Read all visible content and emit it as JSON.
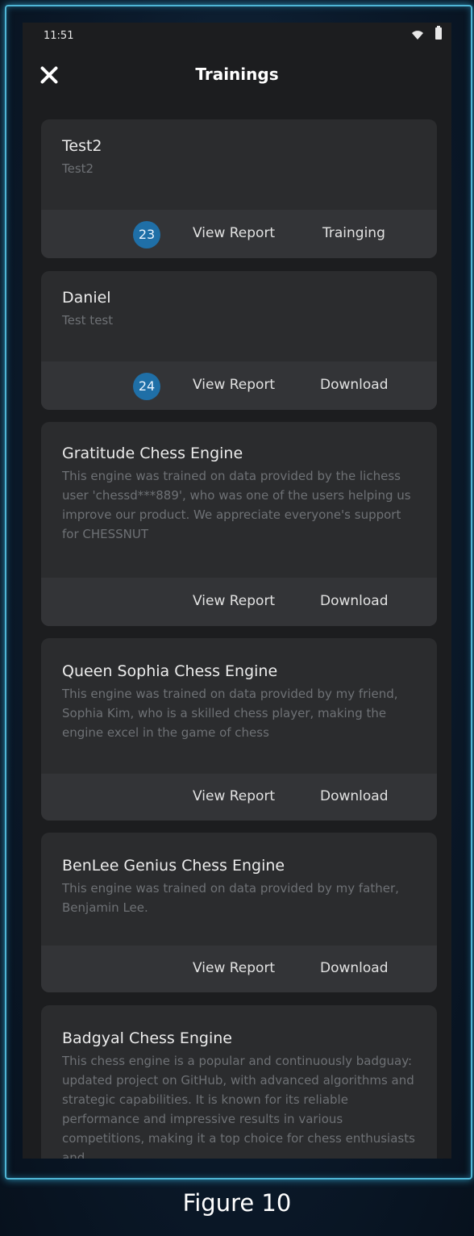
{
  "status_bar": {
    "time": "11:51"
  },
  "header": {
    "title": "Trainings"
  },
  "cards": [
    {
      "title": "Test2",
      "description": "Test2",
      "badge": "23",
      "report_label": "View Report",
      "action_label": "Trainging"
    },
    {
      "title": "Daniel",
      "description": "Test test",
      "badge": "24",
      "report_label": "View Report",
      "action_label": "Download"
    },
    {
      "title": "Gratitude Chess Engine",
      "description": "This engine was trained on data provided by the lichess user 'chessd***889', who was one of the users helping us improve our product. We appreciate everyone's support for CHESSNUT",
      "report_label": "View Report",
      "action_label": "Download"
    },
    {
      "title": "Queen Sophia Chess Engine",
      "description": "This engine was trained on data provided by my friend, Sophia Kim, who is a skilled chess player, making the engine excel in the game of chess",
      "report_label": "View Report",
      "action_label": "Download"
    },
    {
      "title": "BenLee Genius Chess Engine",
      "description": "This engine was trained on data provided by my father, Benjamin Lee.",
      "report_label": "View Report",
      "action_label": "Download"
    },
    {
      "title": "Badgyal Chess Engine",
      "description": "This chess engine is a popular and continuously badguay: updated project on GitHub, with advanced algorithms and strategic capabilities. It is known for its reliable performance and impressive results in various competitions, making it a top choice for chess enthusiasts and"
    }
  ],
  "caption": "Figure 10"
}
